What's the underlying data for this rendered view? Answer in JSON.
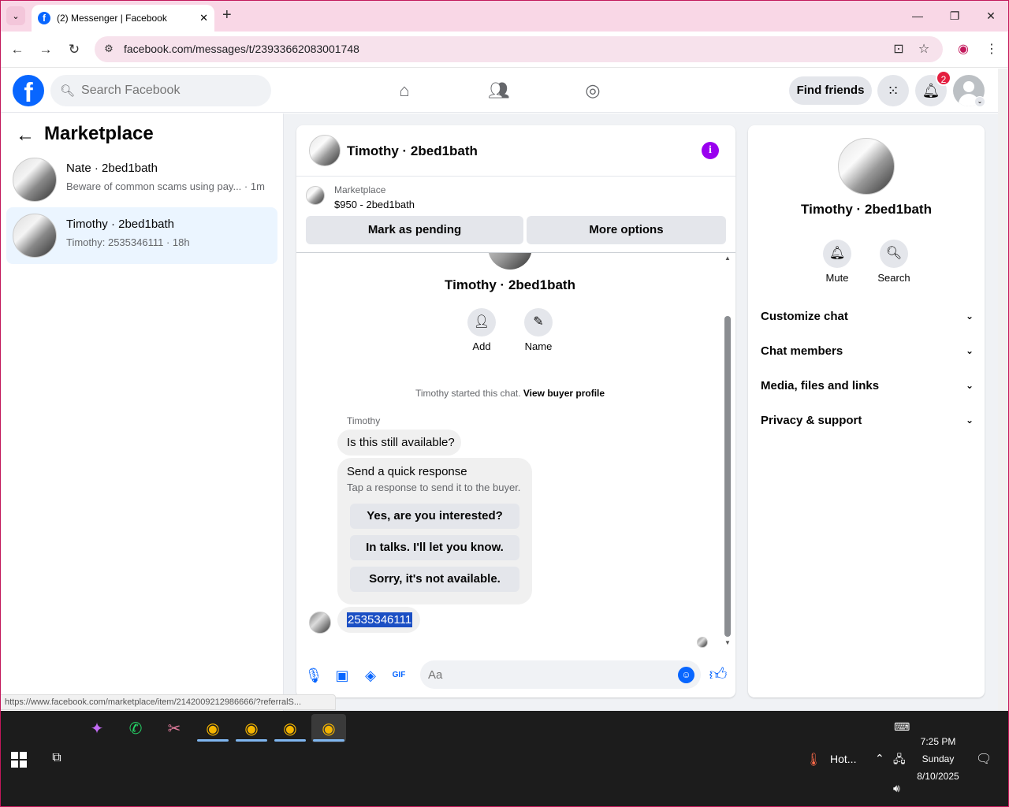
{
  "browser": {
    "tab_title": "(2) Messenger | Facebook",
    "url": "facebook.com/messages/t/23933662083001748",
    "status_url": "https://www.facebook.com/marketplace/item/2142009212986666/?referralS..."
  },
  "facebook_header": {
    "search_placeholder": "Search Facebook",
    "find_friends_label": "Find friends",
    "notification_count": "2"
  },
  "left_pane": {
    "title": "Marketplace",
    "conversations": [
      {
        "name": "Nate · 2bed1bath",
        "preview": "Beware of common scams using pay... · 1m"
      },
      {
        "name": "Timothy · 2bed1bath",
        "preview": "Timothy: 2535346111 · 18h"
      }
    ]
  },
  "chat": {
    "header_title": "Timothy · 2bed1bath",
    "listing_source": "Marketplace",
    "listing_price_title": "$950 - 2bed1bath",
    "mark_pending_label": "Mark as pending",
    "more_options_label": "More options",
    "profile_name": "Timothy · 2bed1bath",
    "add_label": "Add",
    "name_label": "Name",
    "started_text": "Timothy started this chat.",
    "view_buyer_label": "View buyer profile",
    "sender_label": "Timothy",
    "message_1": "Is this still available?",
    "quick_title": "Send a quick response",
    "quick_subtitle": "Tap a response to send it to the buyer.",
    "quick_responses": [
      "Yes, are you interested?",
      "In talks. I'll let you know.",
      "Sorry, it's not available."
    ],
    "message_2": "2535346111",
    "composer_placeholder": "Aa"
  },
  "right_pane": {
    "name": "Timothy · 2bed1bath",
    "mute_label": "Mute",
    "search_label": "Search",
    "sections": [
      "Customize chat",
      "Chat members",
      "Media, files and links",
      "Privacy & support"
    ]
  },
  "taskbar": {
    "weather_text": "Hot...",
    "time": "7:25 PM",
    "day": "Sunday",
    "date": "8/10/2025"
  },
  "colors": {
    "facebook_blue": "#0866ff",
    "tab_strip": "#f9d7e6",
    "info_purple": "#9900ef",
    "badge_red": "#e41e3f",
    "selection_blue": "#1b4fc4"
  }
}
